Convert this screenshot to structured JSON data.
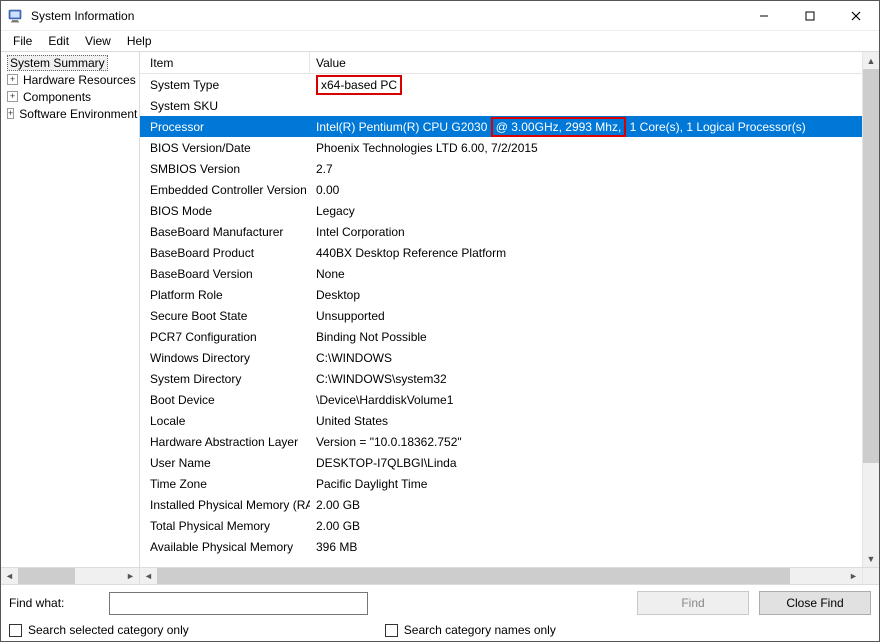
{
  "window": {
    "title": "System Information"
  },
  "menu": {
    "items": [
      "File",
      "Edit",
      "View",
      "Help"
    ]
  },
  "tree": {
    "items": [
      {
        "label": "System Summary",
        "selected": true,
        "expandable": false
      },
      {
        "label": "Hardware Resources",
        "selected": false,
        "expandable": true
      },
      {
        "label": "Components",
        "selected": false,
        "expandable": true
      },
      {
        "label": "Software Environment",
        "selected": false,
        "expandable": true
      }
    ]
  },
  "columns": {
    "item": "Item",
    "value": "Value"
  },
  "rows": [
    {
      "item": "System Type",
      "value": "x64-based PC",
      "highlight_value": true
    },
    {
      "item": "System SKU",
      "value": ""
    },
    {
      "item": "Processor",
      "value_pre": "Intel(R) Pentium(R) CPU G2030 ",
      "value_box": "@ 3.00GHz, 2993 Mhz,",
      "value_post": " 1 Core(s), 1 Logical Processor(s)",
      "selected": true
    },
    {
      "item": "BIOS Version/Date",
      "value": "Phoenix Technologies LTD 6.00, 7/2/2015"
    },
    {
      "item": "SMBIOS Version",
      "value": "2.7"
    },
    {
      "item": "Embedded Controller Version",
      "value": "0.00"
    },
    {
      "item": "BIOS Mode",
      "value": "Legacy"
    },
    {
      "item": "BaseBoard Manufacturer",
      "value": "Intel Corporation"
    },
    {
      "item": "BaseBoard Product",
      "value": "440BX Desktop Reference Platform"
    },
    {
      "item": "BaseBoard Version",
      "value": "None"
    },
    {
      "item": "Platform Role",
      "value": "Desktop"
    },
    {
      "item": "Secure Boot State",
      "value": "Unsupported"
    },
    {
      "item": "PCR7 Configuration",
      "value": "Binding Not Possible"
    },
    {
      "item": "Windows Directory",
      "value": "C:\\WINDOWS"
    },
    {
      "item": "System Directory",
      "value": "C:\\WINDOWS\\system32"
    },
    {
      "item": "Boot Device",
      "value": "\\Device\\HarddiskVolume1"
    },
    {
      "item": "Locale",
      "value": "United States"
    },
    {
      "item": "Hardware Abstraction Layer",
      "value": "Version = \"10.0.18362.752\""
    },
    {
      "item": "User Name",
      "value": "DESKTOP-I7QLBGI\\Linda"
    },
    {
      "item": "Time Zone",
      "value": "Pacific Daylight Time"
    },
    {
      "item": "Installed Physical Memory (RAM)",
      "value": "2.00 GB"
    },
    {
      "item": "Total Physical Memory",
      "value": "2.00 GB"
    },
    {
      "item": "Available Physical Memory",
      "value": "396 MB"
    }
  ],
  "find": {
    "label": "Find what:",
    "value": "",
    "find_button": "Find",
    "close_button": "Close Find",
    "cb_selected": "Search selected category only",
    "cb_names": "Search category names only"
  }
}
